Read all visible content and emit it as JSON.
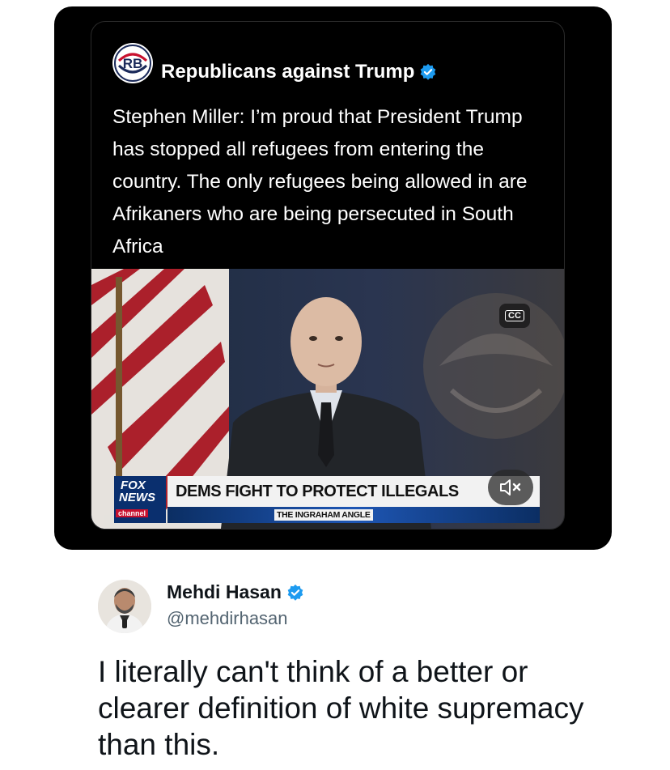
{
  "embedded_tweet": {
    "author_name": "Republicans against Trump",
    "avatar_initials": "RB",
    "verified_icon": "verified-badge-icon",
    "text": "Stephen Miller: I’m proud that President Trump has stopped all refugees from entering the country. The only refugees being allowed in are Afrikaners who are being persecuted in South Africa",
    "video": {
      "cc_label": "CC",
      "network_logo": {
        "line1": "FOX",
        "line2": "NEWS",
        "line3": "channel"
      },
      "chyron": "DEMS FIGHT TO PROTECT ILLEGALS",
      "show_label": "THE INGRAHAM ANGLE",
      "mute_icon": "muted-speaker-icon"
    }
  },
  "quote_tweet": {
    "author_name": "Mehdi Hasan",
    "handle": "@mehdirhasan",
    "verified_icon": "verified-badge-icon",
    "text": "I literally can't think of a better or clearer definition of white supremacy than this."
  },
  "colors": {
    "embed_background": "#000000",
    "verified_blue": "#1d9bf0",
    "primary_text_light": "#ffffff",
    "primary_text_dark": "#0f1419",
    "secondary_text": "#536471",
    "fox_blue": "#0a2f6e",
    "fox_red": "#c8102e"
  }
}
